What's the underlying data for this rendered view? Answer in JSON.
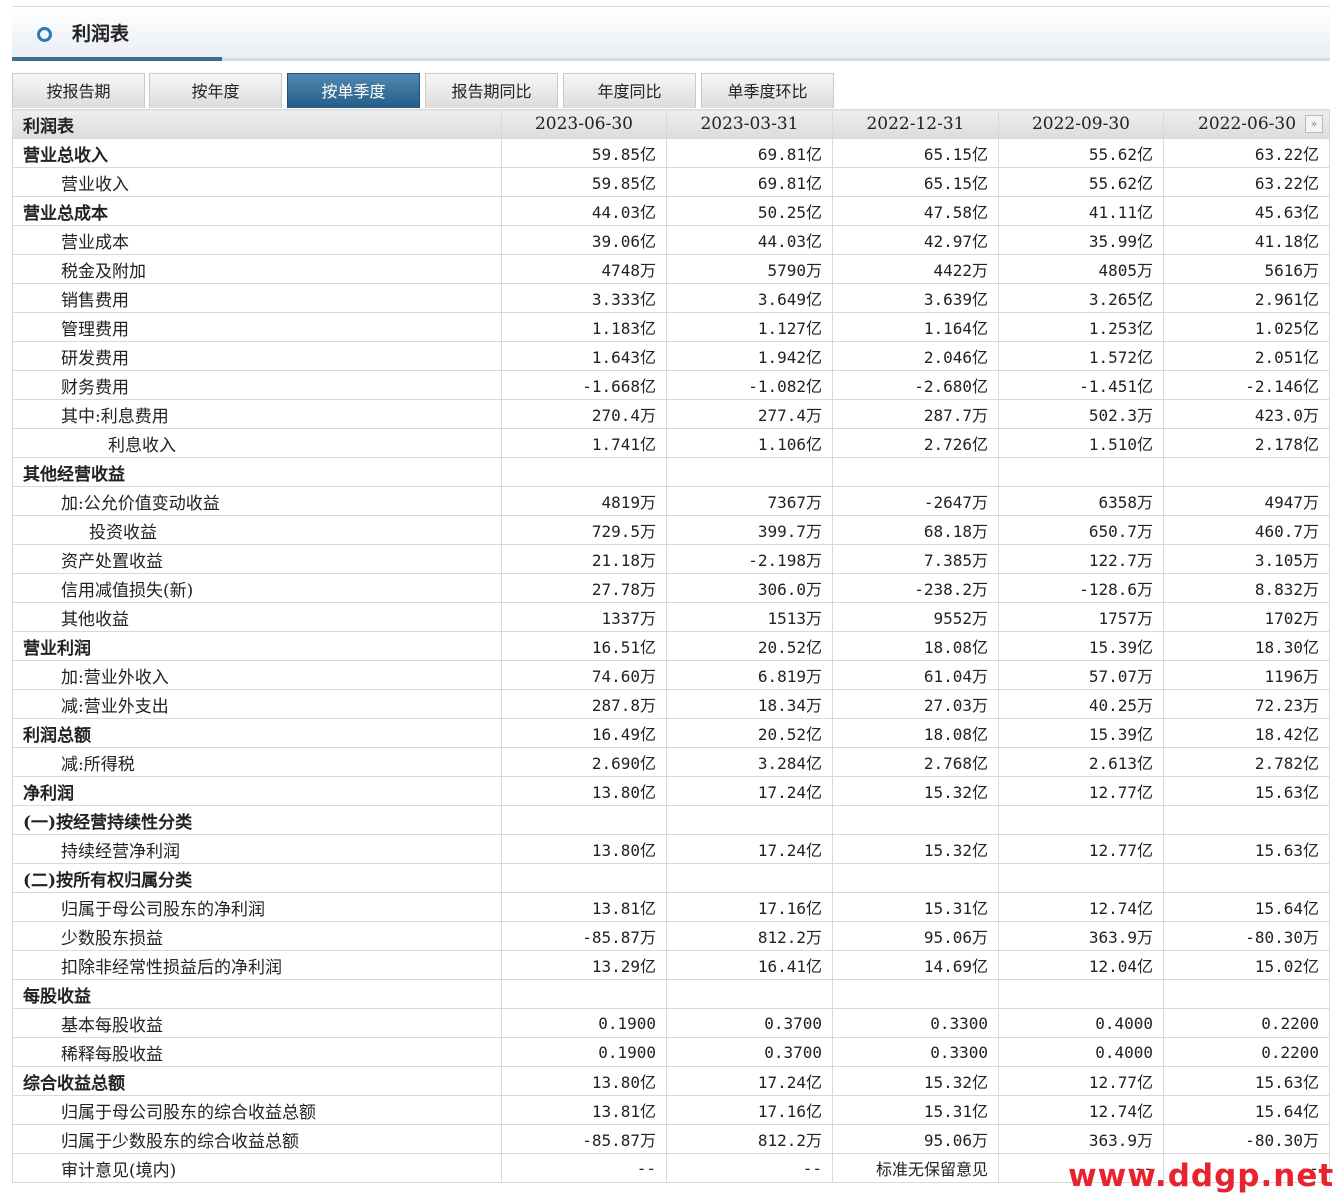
{
  "panel": {
    "title": "利润表"
  },
  "tabs": [
    "按报告期",
    "按年度",
    "按单季度",
    "报告期同比",
    "年度同比",
    "单季度环比"
  ],
  "active_tab": "按单季度",
  "table": {
    "header": [
      "利润表",
      "2023-06-30",
      "2023-03-31",
      "2022-12-31",
      "2022-09-30",
      "2022-06-30"
    ],
    "more_label": "»",
    "rows": [
      {
        "label": "营业总收入",
        "bold": true,
        "indent": 0,
        "values": [
          "59.85亿",
          "69.81亿",
          "65.15亿",
          "55.62亿",
          "63.22亿"
        ]
      },
      {
        "label": "营业收入",
        "bold": false,
        "indent": 1,
        "values": [
          "59.85亿",
          "69.81亿",
          "65.15亿",
          "55.62亿",
          "63.22亿"
        ]
      },
      {
        "label": "营业总成本",
        "bold": true,
        "indent": 0,
        "values": [
          "44.03亿",
          "50.25亿",
          "47.58亿",
          "41.11亿",
          "45.63亿"
        ]
      },
      {
        "label": "营业成本",
        "bold": false,
        "indent": 1,
        "values": [
          "39.06亿",
          "44.03亿",
          "42.97亿",
          "35.99亿",
          "41.18亿"
        ]
      },
      {
        "label": "税金及附加",
        "bold": false,
        "indent": 1,
        "values": [
          "4748万",
          "5790万",
          "4422万",
          "4805万",
          "5616万"
        ]
      },
      {
        "label": "销售费用",
        "bold": false,
        "indent": 1,
        "values": [
          "3.333亿",
          "3.649亿",
          "3.639亿",
          "3.265亿",
          "2.961亿"
        ]
      },
      {
        "label": "管理费用",
        "bold": false,
        "indent": 1,
        "values": [
          "1.183亿",
          "1.127亿",
          "1.164亿",
          "1.253亿",
          "1.025亿"
        ]
      },
      {
        "label": "研发费用",
        "bold": false,
        "indent": 1,
        "values": [
          "1.643亿",
          "1.942亿",
          "2.046亿",
          "1.572亿",
          "2.051亿"
        ]
      },
      {
        "label": "财务费用",
        "bold": false,
        "indent": 1,
        "values": [
          "-1.668亿",
          "-1.082亿",
          "-2.680亿",
          "-1.451亿",
          "-2.146亿"
        ]
      },
      {
        "label": "其中:利息费用",
        "bold": false,
        "indent": 1,
        "values": [
          "270.4万",
          "277.4万",
          "287.7万",
          "502.3万",
          "423.0万"
        ]
      },
      {
        "label": "利息收入",
        "bold": false,
        "indent": 2,
        "values": [
          "1.741亿",
          "1.106亿",
          "2.726亿",
          "1.510亿",
          "2.178亿"
        ]
      },
      {
        "label": "其他经营收益",
        "bold": true,
        "indent": 0,
        "values": [
          "",
          "",
          "",
          "",
          ""
        ]
      },
      {
        "label": "加:公允价值变动收益",
        "bold": false,
        "indent": 1,
        "values": [
          "4819万",
          "7367万",
          "-2647万",
          "6358万",
          "4947万"
        ]
      },
      {
        "label": "投资收益",
        "bold": false,
        "indent": 3,
        "values": [
          "729.5万",
          "399.7万",
          "68.18万",
          "650.7万",
          "460.7万"
        ]
      },
      {
        "label": "资产处置收益",
        "bold": false,
        "indent": 1,
        "values": [
          "21.18万",
          "-2.198万",
          "7.385万",
          "122.7万",
          "3.105万"
        ]
      },
      {
        "label": "信用减值损失(新)",
        "bold": false,
        "indent": 1,
        "values": [
          "27.78万",
          "306.0万",
          "-238.2万",
          "-128.6万",
          "8.832万"
        ]
      },
      {
        "label": "其他收益",
        "bold": false,
        "indent": 1,
        "values": [
          "1337万",
          "1513万",
          "9552万",
          "1757万",
          "1702万"
        ]
      },
      {
        "label": "营业利润",
        "bold": true,
        "indent": 0,
        "values": [
          "16.51亿",
          "20.52亿",
          "18.08亿",
          "15.39亿",
          "18.30亿"
        ]
      },
      {
        "label": "加:营业外收入",
        "bold": false,
        "indent": 1,
        "values": [
          "74.60万",
          "6.819万",
          "61.04万",
          "57.07万",
          "1196万"
        ]
      },
      {
        "label": "减:营业外支出",
        "bold": false,
        "indent": 1,
        "values": [
          "287.8万",
          "18.34万",
          "27.03万",
          "40.25万",
          "72.23万"
        ]
      },
      {
        "label": "利润总额",
        "bold": true,
        "indent": 0,
        "values": [
          "16.49亿",
          "20.52亿",
          "18.08亿",
          "15.39亿",
          "18.42亿"
        ]
      },
      {
        "label": "减:所得税",
        "bold": false,
        "indent": 1,
        "values": [
          "2.690亿",
          "3.284亿",
          "2.768亿",
          "2.613亿",
          "2.782亿"
        ]
      },
      {
        "label": "净利润",
        "bold": true,
        "indent": 0,
        "values": [
          "13.80亿",
          "17.24亿",
          "15.32亿",
          "12.77亿",
          "15.63亿"
        ]
      },
      {
        "label": "(一)按经营持续性分类",
        "bold": true,
        "indent": 0,
        "values": [
          "",
          "",
          "",
          "",
          ""
        ]
      },
      {
        "label": "持续经营净利润",
        "bold": false,
        "indent": 1,
        "values": [
          "13.80亿",
          "17.24亿",
          "15.32亿",
          "12.77亿",
          "15.63亿"
        ]
      },
      {
        "label": "(二)按所有权归属分类",
        "bold": true,
        "indent": 0,
        "values": [
          "",
          "",
          "",
          "",
          ""
        ]
      },
      {
        "label": "归属于母公司股东的净利润",
        "bold": false,
        "indent": 1,
        "values": [
          "13.81亿",
          "17.16亿",
          "15.31亿",
          "12.74亿",
          "15.64亿"
        ]
      },
      {
        "label": "少数股东损益",
        "bold": false,
        "indent": 1,
        "values": [
          "-85.87万",
          "812.2万",
          "95.06万",
          "363.9万",
          "-80.30万"
        ]
      },
      {
        "label": "扣除非经常性损益后的净利润",
        "bold": false,
        "indent": 1,
        "values": [
          "13.29亿",
          "16.41亿",
          "14.69亿",
          "12.04亿",
          "15.02亿"
        ]
      },
      {
        "label": "每股收益",
        "bold": true,
        "indent": 0,
        "values": [
          "",
          "",
          "",
          "",
          ""
        ]
      },
      {
        "label": "基本每股收益",
        "bold": false,
        "indent": 1,
        "values": [
          "0.1900",
          "0.3700",
          "0.3300",
          "0.4000",
          "0.2200"
        ]
      },
      {
        "label": "稀释每股收益",
        "bold": false,
        "indent": 1,
        "values": [
          "0.1900",
          "0.3700",
          "0.3300",
          "0.4000",
          "0.2200"
        ]
      },
      {
        "label": "综合收益总额",
        "bold": true,
        "indent": 0,
        "values": [
          "13.80亿",
          "17.24亿",
          "15.32亿",
          "12.77亿",
          "15.63亿"
        ]
      },
      {
        "label": "归属于母公司股东的综合收益总额",
        "bold": false,
        "indent": 1,
        "values": [
          "13.81亿",
          "17.16亿",
          "15.31亿",
          "12.74亿",
          "15.64亿"
        ]
      },
      {
        "label": "归属于少数股东的综合收益总额",
        "bold": false,
        "indent": 1,
        "values": [
          "-85.87万",
          "812.2万",
          "95.06万",
          "363.9万",
          "-80.30万"
        ]
      },
      {
        "label": "审计意见(境内)",
        "bold": false,
        "indent": 1,
        "values": [
          "--",
          "--",
          "标准无保留意见",
          "--",
          "--"
        ]
      }
    ]
  },
  "watermark": "www.ddgp.net",
  "colors": {
    "active_tab": "#265d88",
    "accent": "#3d6f88",
    "watermark": "#e8232f"
  }
}
